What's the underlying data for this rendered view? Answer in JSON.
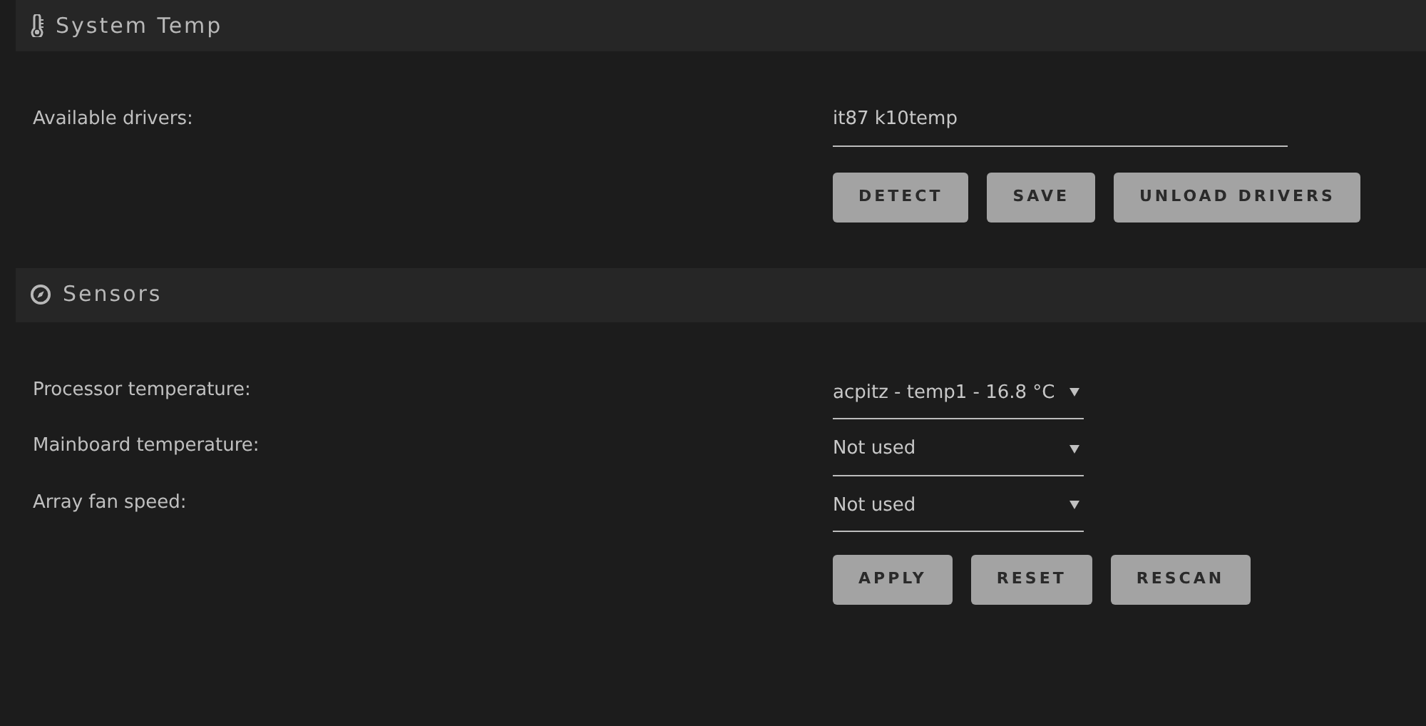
{
  "sections": [
    {
      "title": "System Temp",
      "rows": [
        {
          "label": "Available drivers:",
          "kind": "input",
          "value": "it87 k10temp"
        }
      ],
      "buttons": [
        "DETECT",
        "SAVE",
        "UNLOAD DRIVERS"
      ]
    },
    {
      "title": "Sensors",
      "rows": [
        {
          "label": "Processor temperature:",
          "kind": "select",
          "value": "acpitz - temp1 - 16.8 °C"
        },
        {
          "label": "Mainboard temperature:",
          "kind": "select",
          "value": "Not used"
        },
        {
          "label": "Array fan speed:",
          "kind": "select",
          "value": "Not used"
        }
      ],
      "buttons": [
        "APPLY",
        "RESET",
        "RESCAN"
      ]
    }
  ]
}
